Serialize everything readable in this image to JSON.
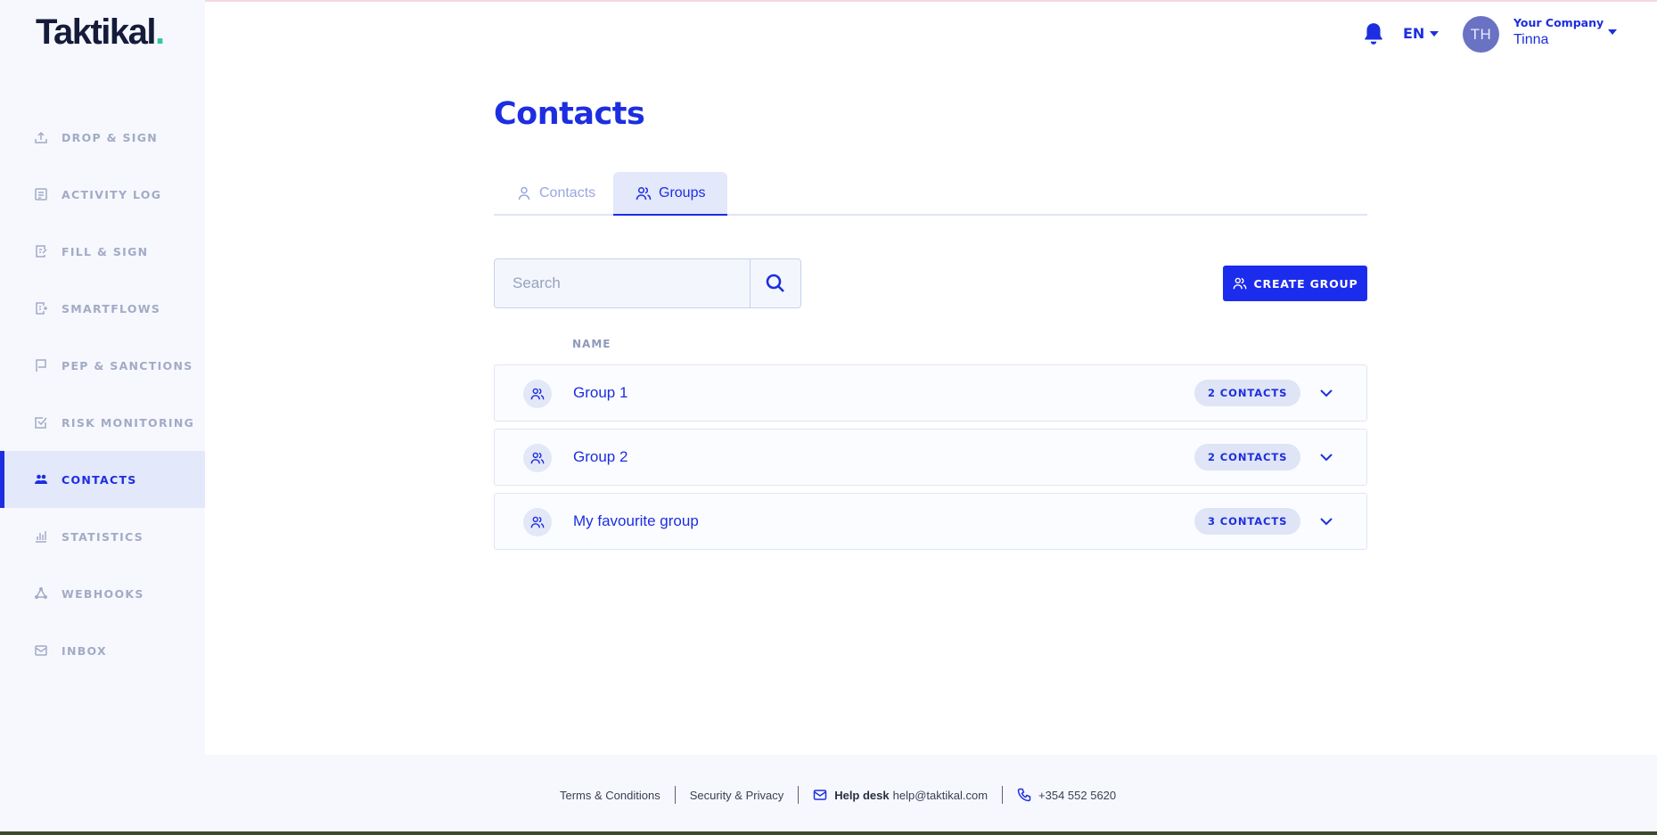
{
  "brand": {
    "name": "Taktikal",
    "dot": "."
  },
  "sidebar": {
    "items": [
      {
        "label": "DROP & SIGN",
        "icon": "upload-icon"
      },
      {
        "label": "ACTIVITY LOG",
        "icon": "list-icon"
      },
      {
        "label": "FILL & SIGN",
        "icon": "document-edit-icon"
      },
      {
        "label": "SMARTFLOWS",
        "icon": "document-flow-icon"
      },
      {
        "label": "PEP & SANCTIONS",
        "icon": "flag-icon"
      },
      {
        "label": "RISK MONITORING",
        "icon": "checkbox-icon"
      },
      {
        "label": "CONTACTS",
        "icon": "users-icon",
        "active": true
      },
      {
        "label": "STATISTICS",
        "icon": "bar-chart-icon"
      },
      {
        "label": "WEBHOOKS",
        "icon": "webhook-icon"
      },
      {
        "label": "INBOX",
        "icon": "mail-icon"
      }
    ]
  },
  "header": {
    "language": "EN",
    "avatar_initials": "TH",
    "company": "Your Company",
    "user": "Tinna"
  },
  "page": {
    "title": "Contacts",
    "tabs": [
      {
        "label": "Contacts",
        "active": false
      },
      {
        "label": "Groups",
        "active": true
      }
    ],
    "search": {
      "placeholder": "Search"
    },
    "create_button": "CREATE GROUP",
    "column_name": "NAME",
    "groups": [
      {
        "name": "Group 1",
        "count": "2 CONTACTS"
      },
      {
        "name": "Group 2",
        "count": "2 CONTACTS"
      },
      {
        "name": "My favourite group",
        "count": "3 CONTACTS"
      }
    ]
  },
  "footer": {
    "terms": "Terms & Conditions",
    "security": "Security & Privacy",
    "helpdesk_label": "Help desk",
    "helpdesk_email": "help@taktikal.com",
    "phone": "+354 552 5620"
  },
  "colors": {
    "accent": "#1d2ee0",
    "sidebar_bg": "#f6f8fd",
    "active_bg": "#e3e8fa",
    "logo_dot": "#34c8a0"
  }
}
